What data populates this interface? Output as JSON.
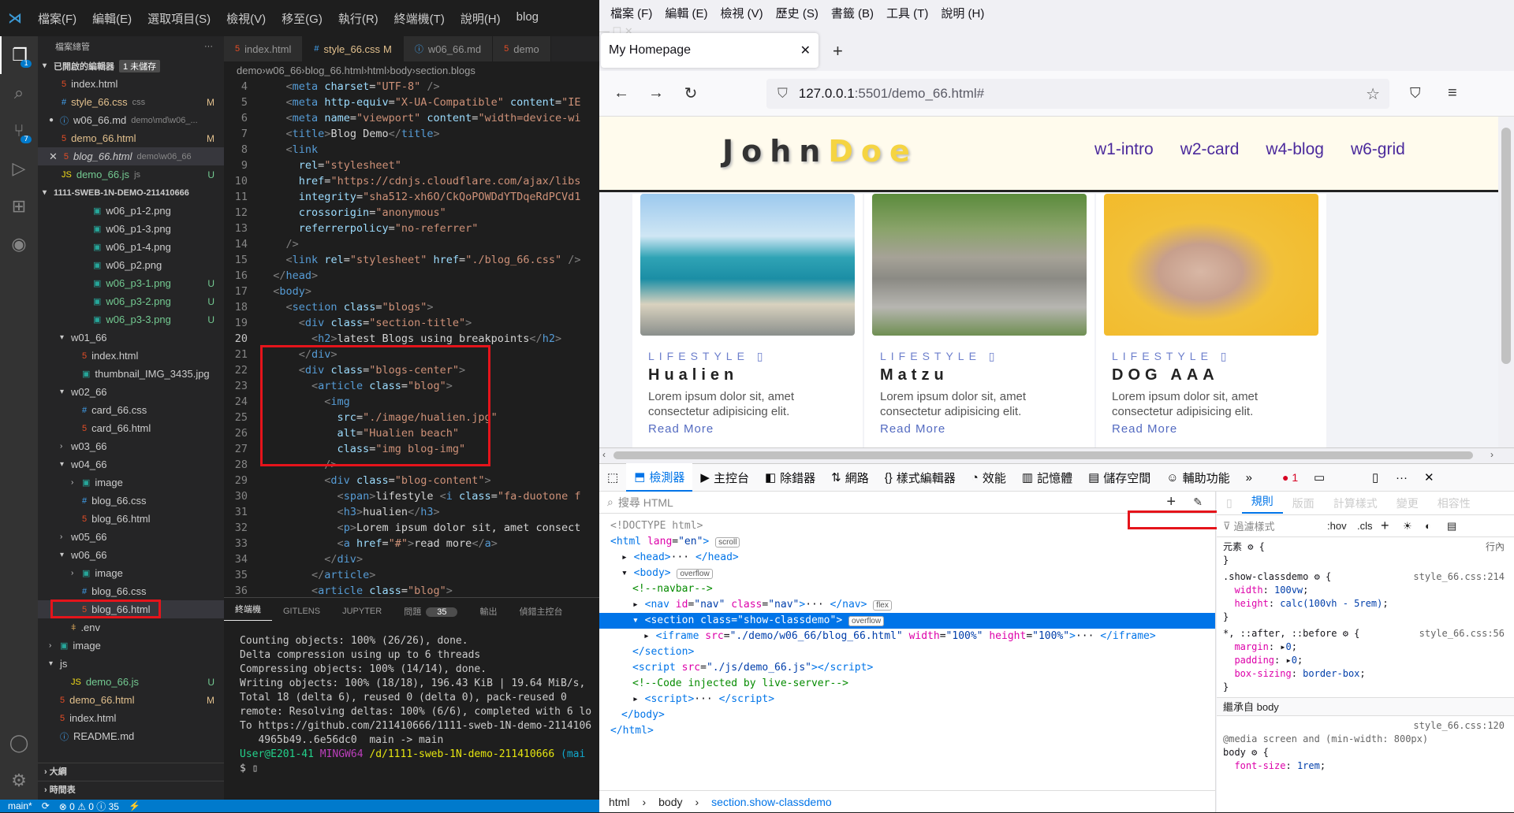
{
  "vscode": {
    "menu": [
      "檔案(F)",
      "編輯(E)",
      "選取項目(S)",
      "檢視(V)",
      "移至(G)",
      "執行(R)",
      "終端機(T)",
      "說明(H)",
      "blog"
    ],
    "explorer_title": "檔案總管",
    "open_editors": {
      "label": "已開啟的編輯器",
      "badge": "1 未儲存"
    },
    "open_files": [
      {
        "name": "index.html",
        "type": "html",
        "sub": "",
        "dec": ""
      },
      {
        "name": "style_66.css",
        "type": "css",
        "sub": "css",
        "dec": "M"
      },
      {
        "name": "w06_66.md",
        "type": "md",
        "sub": "demo\\md\\w06_...",
        "dec": ""
      },
      {
        "name": "demo_66.html",
        "type": "html",
        "sub": "",
        "dec": "M"
      },
      {
        "name": "blog_66.html",
        "type": "html",
        "sub": "demo\\w06_66",
        "dec": ""
      },
      {
        "name": "demo_66.js",
        "type": "js",
        "sub": "js",
        "dec": "U"
      }
    ],
    "workspace": "1111-SWEB-1N-DEMO-211410666",
    "tree": [
      {
        "name": "w06_p1-2.png",
        "type": "img",
        "dec": ""
      },
      {
        "name": "w06_p1-3.png",
        "type": "img",
        "dec": ""
      },
      {
        "name": "w06_p1-4.png",
        "type": "img",
        "dec": ""
      },
      {
        "name": "w06_p2.png",
        "type": "img",
        "dec": ""
      },
      {
        "name": "w06_p3-1.png",
        "type": "img",
        "dec": "U"
      },
      {
        "name": "w06_p3-2.png",
        "type": "img",
        "dec": "U"
      },
      {
        "name": "w06_p3-3.png",
        "type": "img",
        "dec": "U"
      },
      {
        "name": "w01_66",
        "type": "folder",
        "open": true
      },
      {
        "name": "index.html",
        "type": "html",
        "dec": ""
      },
      {
        "name": "thumbnail_IMG_3435.jpg",
        "type": "img",
        "dec": ""
      },
      {
        "name": "w02_66",
        "type": "folder",
        "open": true
      },
      {
        "name": "card_66.css",
        "type": "css",
        "dec": ""
      },
      {
        "name": "card_66.html",
        "type": "html",
        "dec": ""
      },
      {
        "name": "w03_66",
        "type": "folder",
        "open": false
      },
      {
        "name": "w04_66",
        "type": "folder",
        "open": true
      },
      {
        "name": "image",
        "type": "imgfolder",
        "open": false
      },
      {
        "name": "blog_66.css",
        "type": "css",
        "dec": ""
      },
      {
        "name": "blog_66.html",
        "type": "html",
        "dec": ""
      },
      {
        "name": "w05_66",
        "type": "folder",
        "open": false
      },
      {
        "name": "w06_66",
        "type": "folder",
        "open": true
      },
      {
        "name": "image",
        "type": "imgfolder",
        "open": false
      },
      {
        "name": "blog_66.css",
        "type": "css",
        "dec": ""
      },
      {
        "name": "blog_66.html",
        "type": "html",
        "dec": ""
      },
      {
        "name": ".env",
        "type": "env",
        "dec": ""
      },
      {
        "name": "image",
        "type": "imgfolder",
        "open": false
      },
      {
        "name": "js",
        "type": "folder",
        "open": true
      },
      {
        "name": "demo_66.js",
        "type": "js",
        "dec": "U"
      },
      {
        "name": "demo_66.html",
        "type": "html",
        "dec": "M"
      },
      {
        "name": "index.html",
        "type": "html",
        "dec": ""
      },
      {
        "name": "README.md",
        "type": "md",
        "dec": ""
      }
    ],
    "outline": [
      "大綱",
      "時間表"
    ],
    "tabs": [
      {
        "name": "index.html",
        "type": "html",
        "dec": ""
      },
      {
        "name": "style_66.css",
        "type": "css",
        "dec": "M"
      },
      {
        "name": "w06_66.md",
        "type": "md",
        "dec": ""
      },
      {
        "name": "demo",
        "type": "html",
        "dec": ""
      }
    ],
    "breadcrumb": [
      "demo",
      "w06_66",
      "blog_66.html",
      "html",
      "body",
      "section.blogs"
    ],
    "code_lines": [
      {
        "n": "4",
        "t": "    <meta charset=\"UTF-8\" />"
      },
      {
        "n": "5",
        "t": "    <meta http-equiv=\"X-UA-Compatible\" content=\"IE"
      },
      {
        "n": "6",
        "t": "    <meta name=\"viewport\" content=\"width=device-wi"
      },
      {
        "n": "7",
        "t": "    <title>Blog Demo</title>"
      },
      {
        "n": "8",
        "t": "    <link"
      },
      {
        "n": "9",
        "t": "      rel=\"stylesheet\""
      },
      {
        "n": "10",
        "t": "      href=\"https://cdnjs.cloudflare.com/ajax/libs"
      },
      {
        "n": "11",
        "t": "      integrity=\"sha512-xh6O/CkQoPOWDdYTDqeRdPCVd1"
      },
      {
        "n": "12",
        "t": "      crossorigin=\"anonymous\""
      },
      {
        "n": "13",
        "t": "      referrerpolicy=\"no-referrer\""
      },
      {
        "n": "14",
        "t": "    />"
      },
      {
        "n": "15",
        "t": "    <link rel=\"stylesheet\" href=\"./blog_66.css\" />"
      },
      {
        "n": "16",
        "t": "  </head>"
      },
      {
        "n": "17",
        "t": "  <body>"
      },
      {
        "n": "18",
        "t": "    <section class=\"blogs\">"
      },
      {
        "n": "19",
        "t": "      <div class=\"section-title\">"
      },
      {
        "n": "20",
        "t": "        <h2>latest Blogs using breakpoints</h2>"
      },
      {
        "n": "21",
        "t": "      </div>"
      },
      {
        "n": "22",
        "t": "      <div class=\"blogs-center\">"
      },
      {
        "n": "23",
        "t": "        <article class=\"blog\">"
      },
      {
        "n": "24",
        "t": "          <img"
      },
      {
        "n": "25",
        "t": "            src=\"./image/hualien.jpg\""
      },
      {
        "n": "26",
        "t": "            alt=\"Hualien beach\""
      },
      {
        "n": "27",
        "t": "            class=\"img blog-img\""
      },
      {
        "n": "28",
        "t": "          />"
      },
      {
        "n": "29",
        "t": "          <div class=\"blog-content\">"
      },
      {
        "n": "30",
        "t": "            <span>lifestyle <i class=\"fa-duotone f"
      },
      {
        "n": "31",
        "t": "            <h3>hualien</h3>"
      },
      {
        "n": "32",
        "t": "            <p>Lorem ipsum dolor sit, amet consect"
      },
      {
        "n": "33",
        "t": "            <a href=\"#\">read more</a>"
      },
      {
        "n": "34",
        "t": "          </div>"
      },
      {
        "n": "35",
        "t": "        </article>"
      },
      {
        "n": "36",
        "t": "        <article class=\"blog\">"
      }
    ],
    "panel_tabs": [
      "終端機",
      "GITLENS",
      "JUPYTER",
      "問題",
      "輸出",
      "偵錯主控台"
    ],
    "problems_count": "35",
    "terminal": [
      "Counting objects: 100% (26/26), done.",
      "Delta compression using up to 6 threads",
      "Compressing objects: 100% (14/14), done.",
      "Writing objects: 100% (18/18), 196.43 KiB | 19.64 MiB/s,",
      "Total 18 (delta 6), reused 0 (delta 0), pack-reused 0",
      "remote: Resolving deltas: 100% (6/6), completed with 6 lo",
      "To https://github.com/211410666/1111-sweb-1N-demo-2114106",
      "   4965b49..6e56dc0  main -> main",
      ""
    ],
    "prompt": {
      "user": "User@E201-41",
      "shell": "MINGW64",
      "path": "/d/1111-sweb-1N-demo-211410666",
      "branch": "(mai"
    },
    "status": {
      "branch": "main*",
      "sync": "⟳",
      "errors": "⊗ 0 ⚠ 0 ⓘ 35",
      "port": "⚡"
    }
  },
  "firefox": {
    "menu": [
      "檔案 (F)",
      "編輯 (E)",
      "檢視 (V)",
      "歷史 (S)",
      "書籤 (B)",
      "工具 (T)",
      "說明 (H)"
    ],
    "tab_title": "My Homepage",
    "url_host": "127.0.0.1",
    "url_rest": ":5501/demo_66.html#",
    "site": {
      "logo_a": "John",
      "logo_b": "Doe",
      "nav": [
        "w1-intro",
        "w2-card",
        "w4-blog",
        "w6-grid"
      ],
      "cards": [
        {
          "cat": "LIFESTYLE",
          "title": "Hualien",
          "text": "Lorem ipsum dolor sit, amet consectetur adipisicing elit.",
          "link": "Read More"
        },
        {
          "cat": "LIFESTYLE",
          "title": "Matzu",
          "text": "Lorem ipsum dolor sit, amet consectetur adipisicing elit.",
          "link": "Read More"
        },
        {
          "cat": "LIFESTYLE",
          "title": "DOG AAA",
          "text": "Lorem ipsum dolor sit, amet consectetur adipisicing elit.",
          "link": "Read More"
        }
      ]
    },
    "devtools": {
      "tabs": [
        "檢測器",
        "主控台",
        "除錯器",
        "網路",
        "樣式編輯器",
        "效能",
        "記憶體",
        "儲存空間",
        "輔助功能"
      ],
      "error_count": "1",
      "search_placeholder": "搜尋 HTML",
      "markup": [
        {
          "indent": 0,
          "html": "<span class='md'>&lt;!DOCTYPE html&gt;</span>"
        },
        {
          "indent": 0,
          "html": "<span class='mt'>&lt;html</span> <span class='ma'>lang</span>=<span class='mv'>\"en\"</span><span class='mt'>&gt;</span> <span class='badge'>scroll</span>"
        },
        {
          "indent": 1,
          "html": "▸ <span class='mt'>&lt;head&gt;</span>··· <span class='mt'>&lt;/head&gt;</span>"
        },
        {
          "indent": 1,
          "html": "▾ <span class='mt'>&lt;body&gt;</span> <span class='badge'>overflow</span>"
        },
        {
          "indent": 2,
          "html": "<span class='mc'>&lt;!--navbar--&gt;</span>"
        },
        {
          "indent": 2,
          "html": "▸ <span class='mt'>&lt;nav</span> <span class='ma'>id</span>=<span class='mv'>\"nav\"</span> <span class='ma'>class</span>=<span class='mv'>\"nav\"</span><span class='mt'>&gt;</span>··· <span class='mt'>&lt;/nav&gt;</span> <span class='badge'>flex</span>"
        },
        {
          "indent": 2,
          "sel": true,
          "html": "▾ <span class='mt'>&lt;section</span> <span class='ma'>class</span>=<span class='mv'>\"show-classdemo\"</span><span class='mt'>&gt;</span> <span class='badge'>overflow</span>"
        },
        {
          "indent": 3,
          "html": "▸ <span class='mt'>&lt;iframe</span> <span class='ma'>src</span>=<span class='mv'>\"./demo/w06_66/blog_66.html\"</span> <span class='ma'>width</span>=<span class='mv'>\"100%\"</span> <span class='ma'>height</span>=<span class='mv'>\"100%\"</span><span class='mt'>&gt;</span>··· <span class='mt'>&lt;/iframe&gt;</span>"
        },
        {
          "indent": 2,
          "html": "<span class='mt'>&lt;/section&gt;</span>"
        },
        {
          "indent": 2,
          "html": "<span class='mt'>&lt;script</span> <span class='ma'>src</span>=<span class='mv'>\"./js/demo_66.js\"</span><span class='mt'>&gt;&lt;/script&gt;</span>"
        },
        {
          "indent": 2,
          "html": "<span class='mc'>&lt;!--Code injected by live-server--&gt;</span>"
        },
        {
          "indent": 2,
          "html": "▸ <span class='mt'>&lt;script&gt;</span>··· <span class='mt'>&lt;/script&gt;</span>"
        },
        {
          "indent": 1,
          "html": "<span class='mt'>&lt;/body&gt;</span>"
        },
        {
          "indent": 0,
          "html": "<span class='mt'>&lt;/html&gt;</span>"
        }
      ],
      "crumbs": [
        "html",
        "body",
        "section.show-classdemo"
      ],
      "rule_tabs": [
        "規則",
        "版面",
        "計算樣式",
        "變更",
        "相容性"
      ],
      "filter_placeholder": "過濾樣式",
      "pseudo": ":hov",
      "cls": ".cls",
      "rules": [
        {
          "t": "元素 ⚙ {",
          "src": "行內"
        },
        {
          "t": "}",
          "src": ""
        },
        {
          "t": ".show-classdemo ⚙ {",
          "src": "style_66.css:214"
        },
        {
          "t": "  <span class='pn'>width</span>: <span class='pv'>100vw</span>;",
          "src": ""
        },
        {
          "t": "  <span class='pn'>height</span>: <span class='pv'>calc(100vh - 5rem)</span>;",
          "src": ""
        },
        {
          "t": "}",
          "src": ""
        },
        {
          "t": "*, ::after, ::before ⚙ {",
          "src": "style_66.css:56"
        },
        {
          "t": "  <span class='pn'>margin</span>: ▸<span class='pv'>0</span>;",
          "src": ""
        },
        {
          "t": "  <span class='pn'>padding</span>: ▸<span class='pv'>0</span>;",
          "src": ""
        },
        {
          "t": "  <span class='pn'>box-sizing</span>: <span class='pv'>border-box</span>;",
          "src": ""
        },
        {
          "t": "}",
          "src": ""
        }
      ],
      "inherited": "繼承自 body",
      "media_src": "style_66.css:120",
      "media": "@media screen and (min-width: 800px)",
      "body_rule": "body ⚙ {",
      "body_prop": "  <span class='pn'>font-size</span>: <span class='pv'>1rem</span>;"
    }
  }
}
